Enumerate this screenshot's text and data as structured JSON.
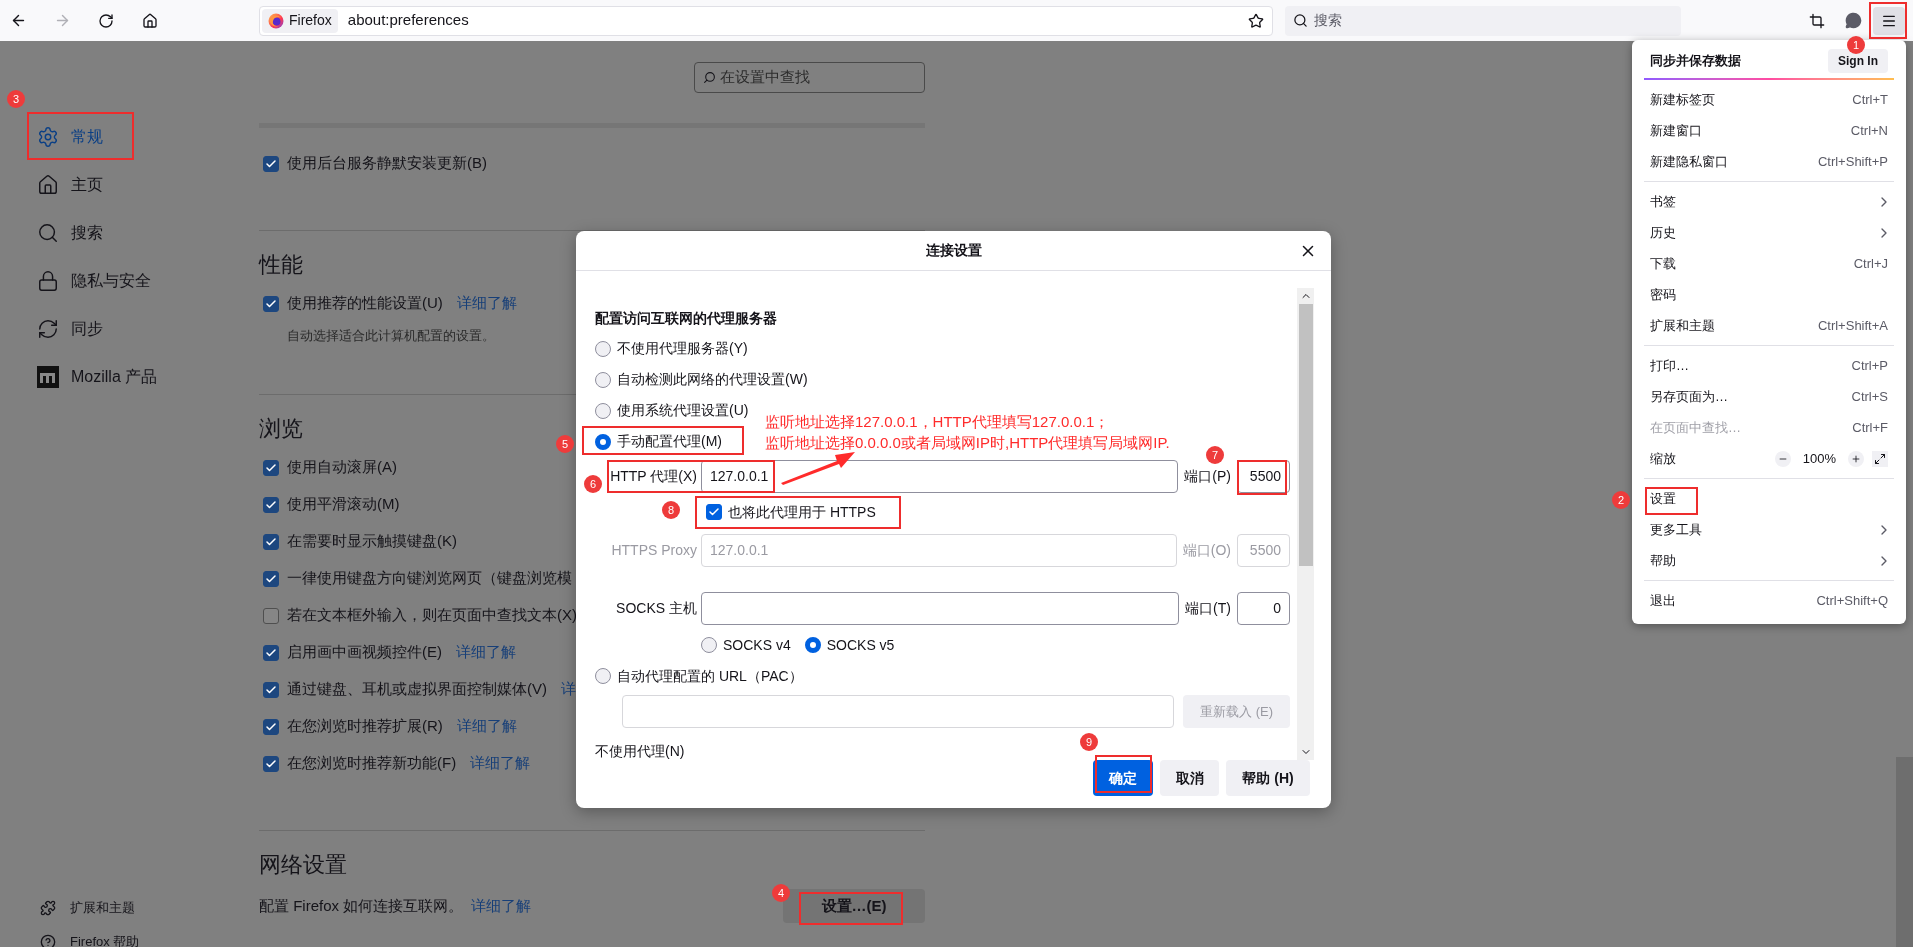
{
  "toolbar": {
    "identity": "Firefox",
    "url": "about:preferences",
    "search_placeholder": "搜索"
  },
  "sidebar": {
    "items": [
      {
        "label": "常规",
        "selected": true
      },
      {
        "label": "主页",
        "selected": false
      },
      {
        "label": "搜索",
        "selected": false
      },
      {
        "label": "隐私与安全",
        "selected": false
      },
      {
        "label": "同步",
        "selected": false
      },
      {
        "label": "Mozilla 产品",
        "selected": false
      }
    ],
    "footer": [
      "扩展和主题",
      "Firefox 帮助"
    ]
  },
  "page": {
    "search_placeholder": "在设置中查找",
    "sections": [
      {
        "items": [
          {
            "label": "使用后台服务静默安装更新(B)",
            "checked": true
          }
        ]
      },
      {
        "heading": "性能",
        "items": [
          {
            "label": "使用推荐的性能设置(U)",
            "checked": true,
            "link": "详细了解",
            "description": "自动选择适合此计算机配置的设置。"
          }
        ]
      },
      {
        "heading": "浏览",
        "items": [
          {
            "label": "使用自动滚屏(A)",
            "checked": true
          },
          {
            "label": "使用平滑滚动(M)",
            "checked": true
          },
          {
            "label": "在需要时显示触摸键盘(K)",
            "checked": true
          },
          {
            "label": "一律使用键盘方向键浏览网页（键盘浏览模",
            "checked": true
          },
          {
            "label": "若在文本框外输入，则在页面中查找文本(X)",
            "checked": false
          },
          {
            "label": "启用画中画视频控件(E)",
            "checked": true,
            "link": "详细了解"
          },
          {
            "label": "通过键盘、耳机或虚拟界面控制媒体(V)",
            "checked": true,
            "link": "详"
          },
          {
            "label": "在您浏览时推荐扩展(R)",
            "checked": true,
            "link": "详细了解"
          },
          {
            "label": "在您浏览时推荐新功能(F)",
            "checked": true,
            "link": "详细了解"
          }
        ]
      }
    ],
    "network": {
      "heading": "网络设置",
      "text": "配置 Firefox 如何连接互联网。",
      "link": "详细了解",
      "button": "设置…(E)"
    }
  },
  "dialog": {
    "title": "连接设置",
    "heading": "配置访问互联网的代理服务器",
    "modes": [
      {
        "label": "不使用代理服务器(Y)",
        "selected": false
      },
      {
        "label": "自动检测此网络的代理设置(W)",
        "selected": false
      },
      {
        "label": "使用系统代理设置(U)",
        "selected": false
      },
      {
        "label": "手动配置代理(M)",
        "selected": true
      }
    ],
    "http_proxy": {
      "label": "HTTP 代理(X)",
      "value": "127.0.0.1",
      "port_label": "端口(P)",
      "port": "5500"
    },
    "also_https": {
      "label": "也将此代理用于 HTTPS",
      "checked": true
    },
    "https_proxy": {
      "label": "HTTPS Proxy",
      "value": "127.0.0.1",
      "port_label": "端口(O)",
      "port": "5500",
      "disabled": true
    },
    "socks": {
      "label": "SOCKS 主机",
      "port_label": "端口(T)",
      "port": "0",
      "versions": [
        {
          "label": "SOCKS v4",
          "selected": false
        },
        {
          "label": "SOCKS v5",
          "selected": true
        }
      ]
    },
    "pac": {
      "label": "自动代理配置的 URL（PAC）",
      "selected": false,
      "reload_button": "重新载入 (E)"
    },
    "no_proxy_label": "不使用代理(N)",
    "buttons": [
      {
        "label": "确定",
        "kind": "primary"
      },
      {
        "label": "取消",
        "kind": "secondary"
      },
      {
        "label": "帮助 (H)",
        "kind": "secondary"
      }
    ]
  },
  "menu": {
    "header": "同步并保存数据",
    "sign_in": "Sign In",
    "groups": [
      [
        {
          "kind": "item",
          "label": "新建标签页",
          "shortcut": "Ctrl+T",
          "disabled": false
        },
        {
          "kind": "item",
          "label": "新建窗口",
          "shortcut": "Ctrl+N",
          "disabled": false
        },
        {
          "kind": "item",
          "label": "新建隐私窗口",
          "shortcut": "Ctrl+Shift+P",
          "disabled": false
        }
      ],
      [
        {
          "kind": "submenu",
          "label": "书签",
          "disabled": false
        },
        {
          "kind": "submenu",
          "label": "历史",
          "disabled": false
        },
        {
          "kind": "item",
          "label": "下载",
          "shortcut": "Ctrl+J",
          "disabled": false
        },
        {
          "kind": "item",
          "label": "密码",
          "disabled": false
        },
        {
          "kind": "item",
          "label": "扩展和主题",
          "shortcut": "Ctrl+Shift+A",
          "disabled": false
        }
      ],
      [
        {
          "kind": "item",
          "label": "打印…",
          "shortcut": "Ctrl+P",
          "disabled": false
        },
        {
          "kind": "item",
          "label": "另存页面为…",
          "shortcut": "Ctrl+S",
          "disabled": false
        },
        {
          "kind": "item",
          "label": "在页面中查找…",
          "shortcut": "Ctrl+F",
          "disabled": true
        },
        {
          "kind": "zoom",
          "label": "缩放",
          "value": "100%",
          "disabled": false
        }
      ],
      [
        {
          "kind": "item",
          "label": "设置",
          "disabled": false
        },
        {
          "kind": "submenu",
          "label": "更多工具",
          "disabled": false
        },
        {
          "kind": "submenu",
          "label": "帮助",
          "disabled": false
        }
      ],
      [
        {
          "kind": "item",
          "label": "退出",
          "shortcut": "Ctrl+Shift+Q",
          "disabled": false
        }
      ]
    ]
  },
  "annotations": {
    "notes": [
      "监听地址选择127.0.0.1，HTTP代理填写127.0.0.1；",
      "监听地址选择0.0.0.0或者局域网IP时,HTTP代理填写局域网IP."
    ],
    "markers": [
      "1",
      "2",
      "3",
      "4",
      "5",
      "6",
      "7",
      "8",
      "9"
    ]
  }
}
